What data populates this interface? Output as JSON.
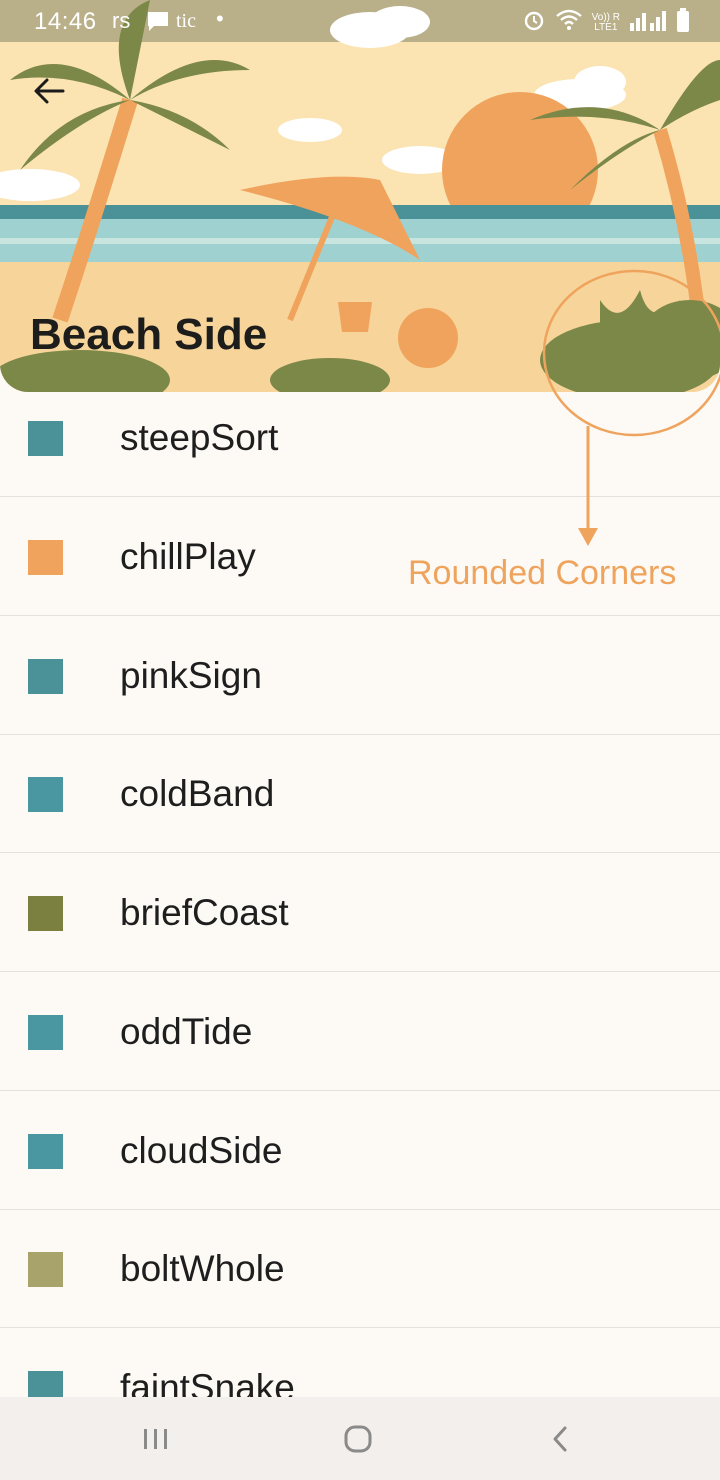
{
  "status_bar": {
    "time": "14:46",
    "carrier": "rs",
    "carrier_extra": "tic",
    "dot": "•",
    "alarm_icon": "alarm-icon",
    "wifi_icon": "wifi-icon",
    "volte": "Vo)) R",
    "lte": "LTE1",
    "signal_icon": "signal-icon",
    "battery_icon": "battery-icon"
  },
  "header": {
    "title": "Beach Side",
    "back_icon": "arrow-back-icon"
  },
  "annotation": {
    "label": "Rounded Corners",
    "color": "#efa45d"
  },
  "list": {
    "items": [
      {
        "label": "steepSort",
        "color": "#4a9198"
      },
      {
        "label": "chillPlay",
        "color": "#f0a35c"
      },
      {
        "label": "pinkSign",
        "color": "#4a9198"
      },
      {
        "label": "coldBand",
        "color": "#4a96a1"
      },
      {
        "label": "briefCoast",
        "color": "#7b7f3f"
      },
      {
        "label": "oddTide",
        "color": "#4a96a1"
      },
      {
        "label": "cloudSide",
        "color": "#4a96a1"
      },
      {
        "label": "boltWhole",
        "color": "#a8a36a"
      },
      {
        "label": "faintSnake",
        "color": "#4a9198"
      }
    ]
  },
  "nav_bar": {
    "recents_icon": "recents-icon",
    "home_icon": "home-icon",
    "back_icon": "back-icon"
  }
}
